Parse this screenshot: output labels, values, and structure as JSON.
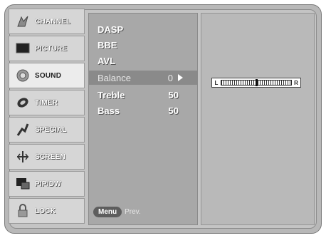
{
  "sidebar": {
    "items": [
      {
        "label": "CHANNEL",
        "icon": "channel-icon"
      },
      {
        "label": "PICTURE",
        "icon": "picture-icon"
      },
      {
        "label": "SOUND",
        "icon": "sound-icon",
        "active": true
      },
      {
        "label": "TIMER",
        "icon": "timer-icon"
      },
      {
        "label": "SPECIAL",
        "icon": "special-icon"
      },
      {
        "label": "SCREEN",
        "icon": "screen-icon"
      },
      {
        "label": "PIP/DW",
        "icon": "pip-icon"
      },
      {
        "label": "LOCK",
        "icon": "lock-icon"
      }
    ]
  },
  "menu": {
    "rows": [
      {
        "label": "DASP",
        "value": ""
      },
      {
        "label": "BBE",
        "value": ""
      },
      {
        "label": "AVL",
        "value": ""
      },
      {
        "label": "Balance",
        "value": "0"
      },
      {
        "label": "Treble",
        "value": "50"
      },
      {
        "label": "Bass",
        "value": "50"
      }
    ],
    "footer": {
      "menu_button": "Menu",
      "prev_label": "Prev."
    }
  },
  "balance_bar": {
    "left_label": "L",
    "right_label": "R",
    "level": 0.5
  }
}
